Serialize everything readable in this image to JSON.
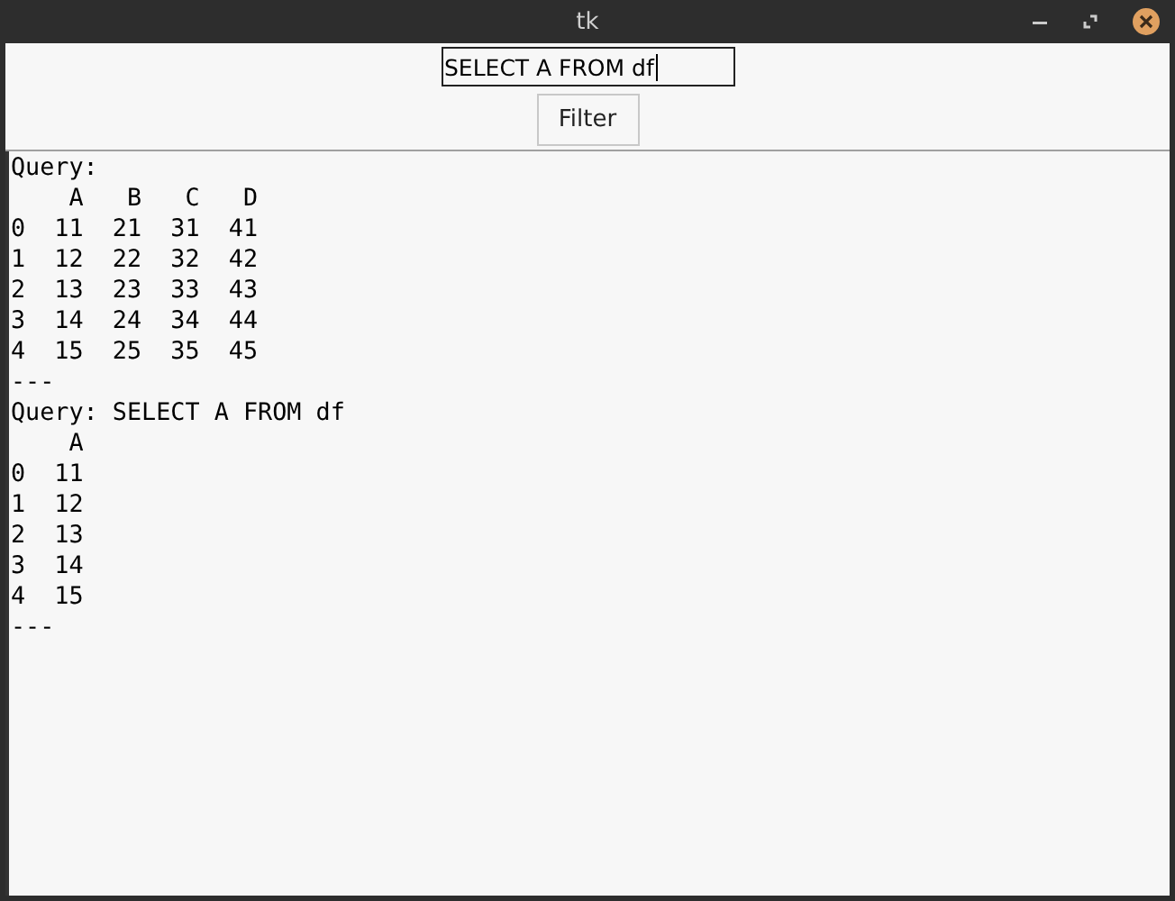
{
  "window": {
    "title": "tk"
  },
  "query_field": {
    "value": "SELECT A FROM df"
  },
  "filter_button": {
    "label": "Filter"
  },
  "output_lines": [
    "Query:",
    "    A   B   C   D",
    "0  11  21  31  41",
    "1  12  22  32  42",
    "2  13  23  33  43",
    "3  14  24  34  44",
    "4  15  25  35  45",
    "---",
    "Query: SELECT A FROM df",
    "    A",
    "0  11",
    "1  12",
    "2  13",
    "3  14",
    "4  15",
    "---"
  ]
}
